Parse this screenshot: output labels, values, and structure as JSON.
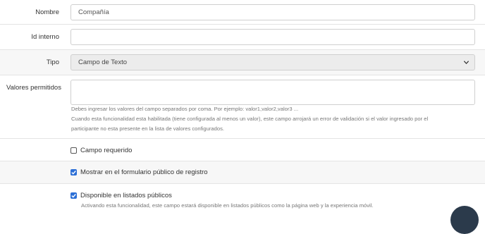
{
  "fields": {
    "nombre": {
      "label": "Nombre",
      "value": "Compañía"
    },
    "id_interno": {
      "label": "Id interno",
      "value": ""
    },
    "tipo": {
      "label": "Tipo",
      "selected": "Campo de Texto"
    },
    "valores": {
      "label": "Valores permitidos",
      "value": "",
      "help": [
        "Debes ingresar los valores del campo separados por coma. Por ejemplo: valor1,valor2,valor3 ...",
        "Cuando esta funcionalidad esta habilitada (tiene configurada al menos un valor), este campo arrojará un error de validación si el valor ingresado por el",
        "participante no esta presente en la lista de valores configurados."
      ]
    }
  },
  "checkboxes": {
    "requerido": {
      "label": "Campo requerido",
      "checked": false
    },
    "formulario": {
      "label": "Mostrar en el formulario público de registro",
      "checked": true
    },
    "listados": {
      "label": "Disponible en listados públicos",
      "checked": true,
      "help": "Activando esta funcionalidad, este campo estará disponible en listados públicos como la página web y la experiencia móvil."
    }
  },
  "colors": {
    "accent": "#2c6fd6",
    "fab": "#2b3a4b"
  }
}
